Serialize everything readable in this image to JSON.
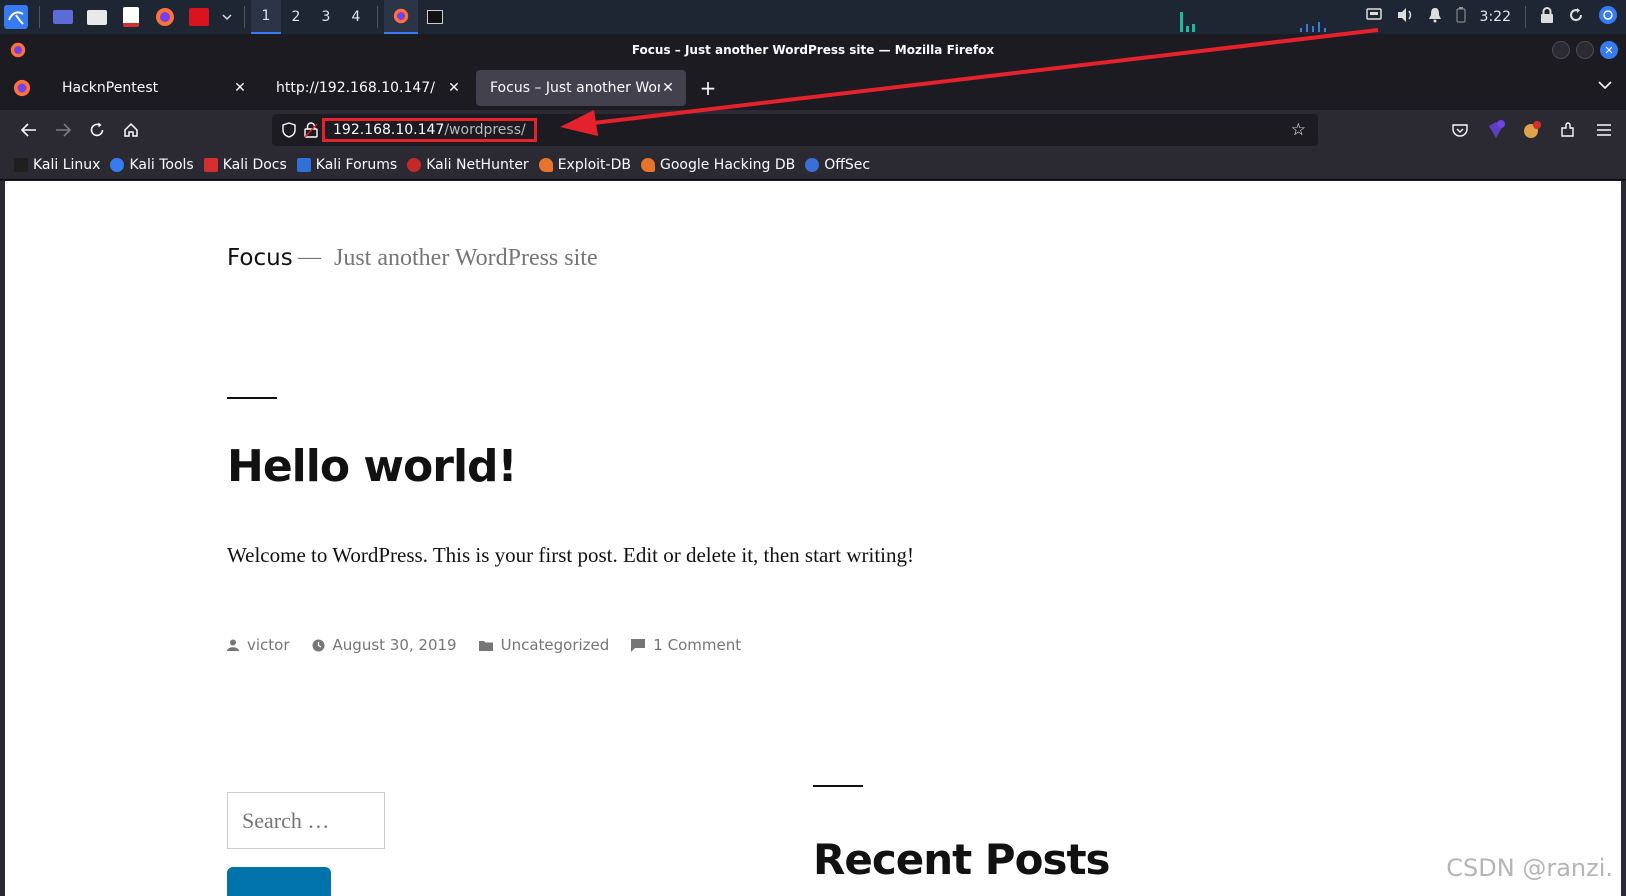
{
  "panel": {
    "workspaces": [
      "1",
      "2",
      "3",
      "4"
    ],
    "active_workspace": 0,
    "clock": "3:22"
  },
  "window": {
    "title": "Focus – Just another WordPress site — Mozilla Firefox"
  },
  "tabs": [
    {
      "label": "HacknPentest",
      "active": false
    },
    {
      "label": "http://192.168.10.147/",
      "active": false
    },
    {
      "label": "Focus – Just another WordPress site",
      "active": true
    }
  ],
  "urlbar": {
    "host": "192.168.10.147",
    "path": "/wordpress/"
  },
  "bookmarks": [
    {
      "label": "Kali Linux",
      "color": "#1f1f1f"
    },
    {
      "label": "Kali Tools",
      "color": "#367bf0"
    },
    {
      "label": "Kali Docs",
      "color": "#d32f2f"
    },
    {
      "label": "Kali Forums",
      "color": "#2f6fd6"
    },
    {
      "label": "Kali NetHunter",
      "color": "#c62828"
    },
    {
      "label": "Exploit-DB",
      "color": "#e8742c"
    },
    {
      "label": "Google Hacking DB",
      "color": "#e8742c"
    },
    {
      "label": "OffSec",
      "color": "#3b6fd8"
    }
  ],
  "site": {
    "title": "Focus",
    "dash": "—",
    "description": "Just another WordPress site"
  },
  "post": {
    "title": "Hello world!",
    "body": "Welcome to WordPress. This is your first post. Edit or delete it, then start writing!",
    "author": "victor",
    "date": "August 30, 2019",
    "category": "Uncategorized",
    "comments": "1 Comment"
  },
  "sidebar": {
    "search_placeholder": "Search …",
    "recent_posts_title": "Recent Posts"
  },
  "watermark": "CSDN @ranzi.",
  "colors": {
    "accent": "#367bf0",
    "annotation": "#e5222b",
    "wp_button": "#0073aa"
  }
}
